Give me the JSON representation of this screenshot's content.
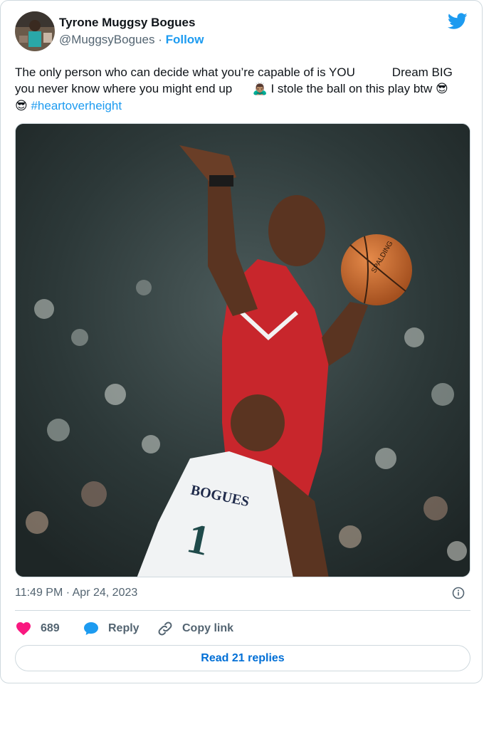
{
  "author": {
    "name": "Tyrone Muggsy Bogues",
    "handle": "@MuggsyBogues",
    "separator": "·",
    "follow_label": "Follow"
  },
  "tweet": {
    "line1": "The only person who can decide what you’re capable of is YOU           Dream BIG",
    "line2_a": "you never know where you might end up      ",
    "line2_emoji": "🙇🏽‍♂️",
    "line2_b": " I stole the ball on this play btw ",
    "line2_emoji2": "😎",
    "line3_emoji": "😎",
    "hashtag": "#heartoverheight"
  },
  "media": {
    "jersey_name": "BOGUES",
    "jersey_number": "1",
    "ball_brand": "SPALDING"
  },
  "meta": {
    "timestamp": "11:49 PM · Apr 24, 2023"
  },
  "actions": {
    "like_count": "689",
    "reply_label": "Reply",
    "copy_label": "Copy link"
  },
  "read_replies_label": "Read 21 replies",
  "colors": {
    "accent": "#1d9bf0",
    "like": "#f91880",
    "muted": "#536471",
    "border": "#cfd9de"
  },
  "icons": [
    "twitter-bird-icon",
    "info-icon",
    "heart-icon",
    "reply-bubble-icon",
    "link-icon"
  ]
}
